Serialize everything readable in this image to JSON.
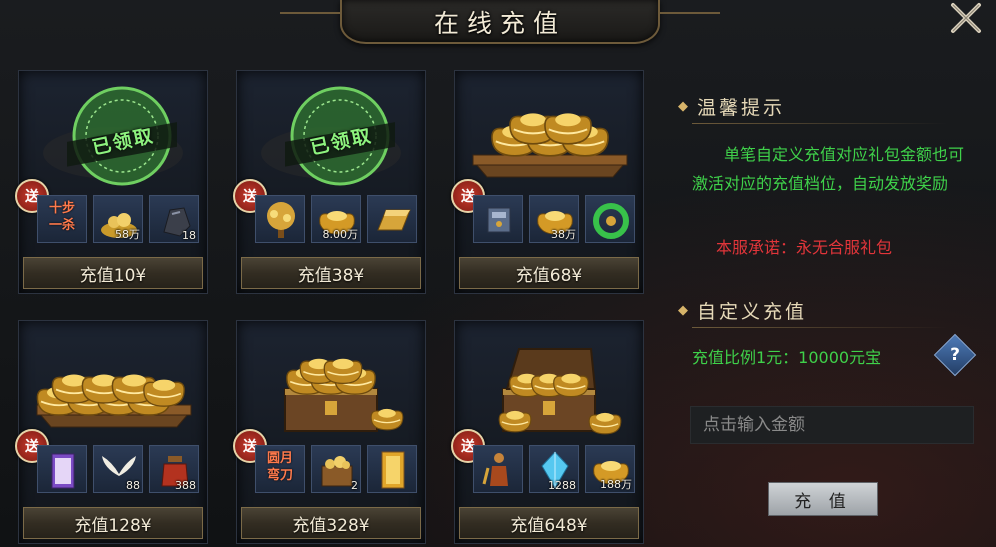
{
  "title": "在线充值",
  "claimed_stamp": "已领取",
  "gift_badge": "送",
  "packages": [
    {
      "price": "充值10¥",
      "claimed": true,
      "items": [
        {
          "icon": "text-item",
          "text": "十步\n一杀",
          "qty": ""
        },
        {
          "icon": "gold-pile-icon",
          "qty": "58万"
        },
        {
          "icon": "ore-icon",
          "qty": "18"
        }
      ]
    },
    {
      "price": "充值38¥",
      "claimed": true,
      "items": [
        {
          "icon": "gold-tree-icon",
          "qty": ""
        },
        {
          "icon": "gold-ingot-icon",
          "qty": "8.00万"
        },
        {
          "icon": "gold-bar-icon",
          "qty": ""
        }
      ]
    },
    {
      "price": "充值68¥",
      "claimed": false,
      "items": [
        {
          "icon": "armor-icon",
          "qty": ""
        },
        {
          "icon": "gold-ingot-icon",
          "qty": "38万"
        },
        {
          "icon": "jade-icon",
          "qty": ""
        }
      ]
    },
    {
      "price": "充值128¥",
      "claimed": false,
      "items": [
        {
          "icon": "scroll-icon",
          "qty": ""
        },
        {
          "icon": "wings-icon",
          "qty": "88"
        },
        {
          "icon": "potion-icon",
          "qty": "388"
        }
      ]
    },
    {
      "price": "充值328¥",
      "claimed": false,
      "items": [
        {
          "icon": "text-item",
          "text": "圆月\n弯刀",
          "qty": ""
        },
        {
          "icon": "gold-crate-icon",
          "qty": "2"
        },
        {
          "icon": "golden-scroll-icon",
          "qty": ""
        }
      ]
    },
    {
      "price": "充值648¥",
      "claimed": false,
      "items": [
        {
          "icon": "character-icon",
          "qty": ""
        },
        {
          "icon": "crystal-icon",
          "qty": "1288"
        },
        {
          "icon": "gold-ingot-icon",
          "qty": "188万"
        }
      ]
    }
  ],
  "tips": {
    "heading": "温馨提示",
    "body": "单笔自定义充值对应礼包金额也可激活对应的充值档位，自动发放奖励",
    "promise": "本服承诺：永无合服礼包"
  },
  "custom": {
    "heading": "自定义充值",
    "ratio": "充值比例1元：10000元宝",
    "input_placeholder": "点击输入金额",
    "input_value": "",
    "submit": "充 值"
  },
  "colors": {
    "tip_green": "#3fd14a",
    "promise_red": "#e2353a",
    "gold": "#d7a53a"
  }
}
